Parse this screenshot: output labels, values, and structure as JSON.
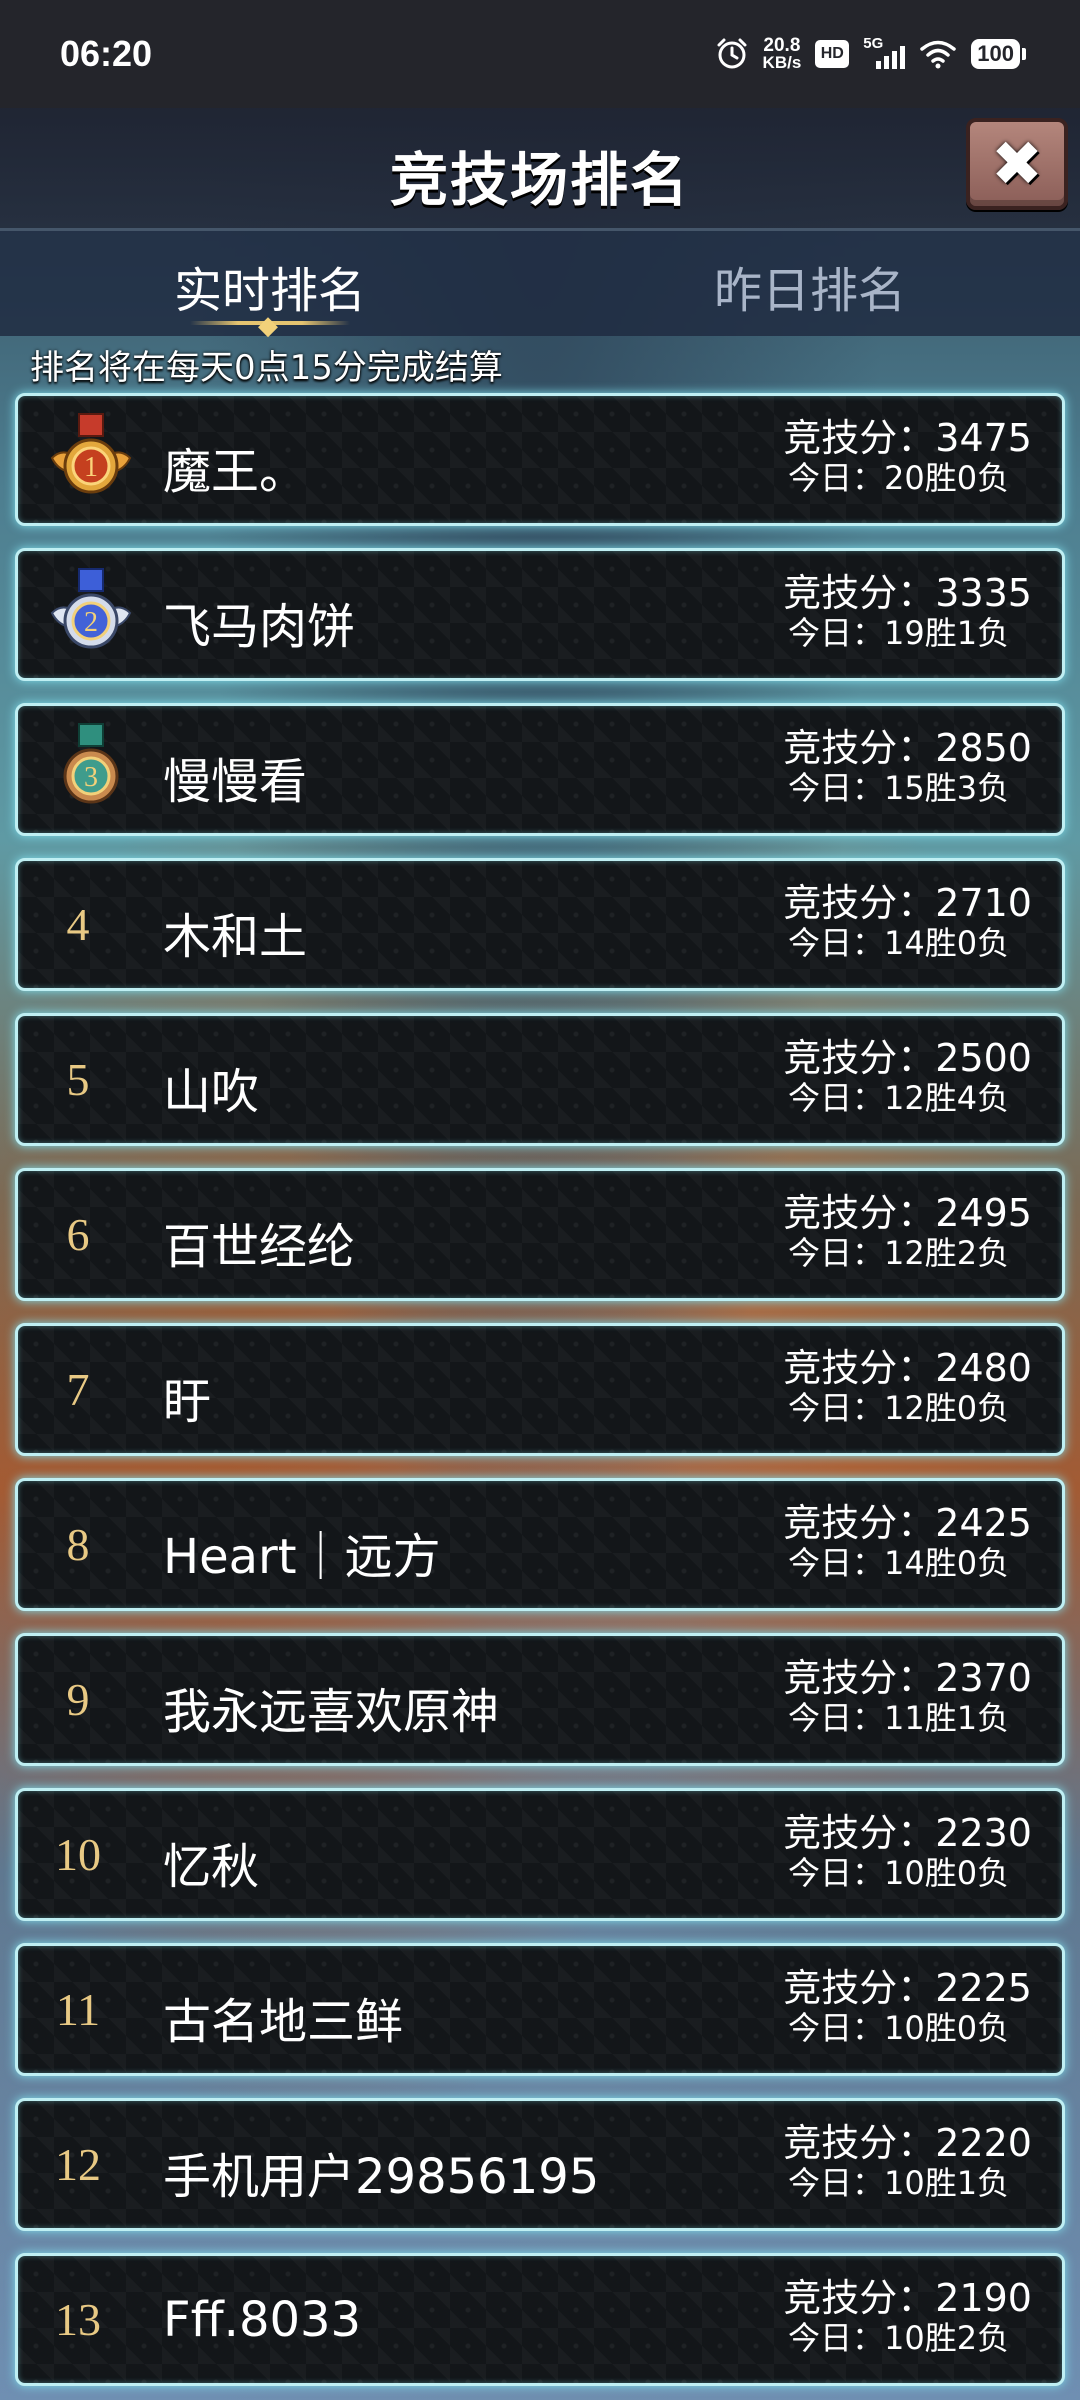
{
  "status_bar": {
    "time": "06:20",
    "net_speed_value": "20.8",
    "net_speed_unit": "KB/s",
    "hd_label": "HD",
    "signal_label": "5G",
    "battery": "100",
    "icons": [
      "alarm-icon",
      "hd-icon",
      "signal-5g-icon",
      "wifi-icon",
      "battery-icon"
    ]
  },
  "header": {
    "title": "竞技场排名",
    "close_icon": "close-icon"
  },
  "tabs": [
    {
      "label": "实时排名",
      "active": true
    },
    {
      "label": "昨日排名",
      "active": false
    }
  ],
  "notice": "排名将在每天0点15分完成结算",
  "ranks": [
    {
      "rank": "1",
      "name": "魔王。",
      "score": "竞技分：3475",
      "today": "今日：20胜0负",
      "medal": "gold"
    },
    {
      "rank": "2",
      "name": "飞马肉饼",
      "score": "竞技分：3335",
      "today": "今日：19胜1负",
      "medal": "silver"
    },
    {
      "rank": "3",
      "name": "慢慢看",
      "score": "竞技分：2850",
      "today": "今日：15胜3负",
      "medal": "bronze"
    },
    {
      "rank": "4",
      "name": "木和土",
      "score": "竞技分：2710",
      "today": "今日：14胜0负"
    },
    {
      "rank": "5",
      "name": "山吹",
      "score": "竞技分：2500",
      "today": "今日：12胜4负"
    },
    {
      "rank": "6",
      "name": "百世经纶",
      "score": "竞技分：2495",
      "today": "今日：12胜2负"
    },
    {
      "rank": "7",
      "name": "盱",
      "score": "竞技分：2480",
      "today": "今日：12胜0负"
    },
    {
      "rank": "8",
      "name": "Heart｜远方",
      "score": "竞技分：2425",
      "today": "今日：14胜0负"
    },
    {
      "rank": "9",
      "name": "我永远喜欢原神",
      "score": "竞技分：2370",
      "today": "今日：11胜1负"
    },
    {
      "rank": "10",
      "name": "忆秋",
      "score": "竞技分：2230",
      "today": "今日：10胜0负"
    },
    {
      "rank": "11",
      "name": "古名地三鲜",
      "score": "竞技分：2225",
      "today": "今日：10胜0负"
    },
    {
      "rank": "12",
      "name": "手机用户29856195",
      "score": "竞技分：2220",
      "today": "今日：10胜1负"
    },
    {
      "rank": "13",
      "name": "Fff.8033",
      "score": "竞技分：2190",
      "today": "今日：10胜2负"
    }
  ],
  "colors": {
    "row_border": "#bfeff3",
    "row_bg": "#131619",
    "rank_text": "#e8c984",
    "gold": "#d9a435",
    "silver": "#6f8ee8",
    "bronze": "#3f9c8c"
  }
}
